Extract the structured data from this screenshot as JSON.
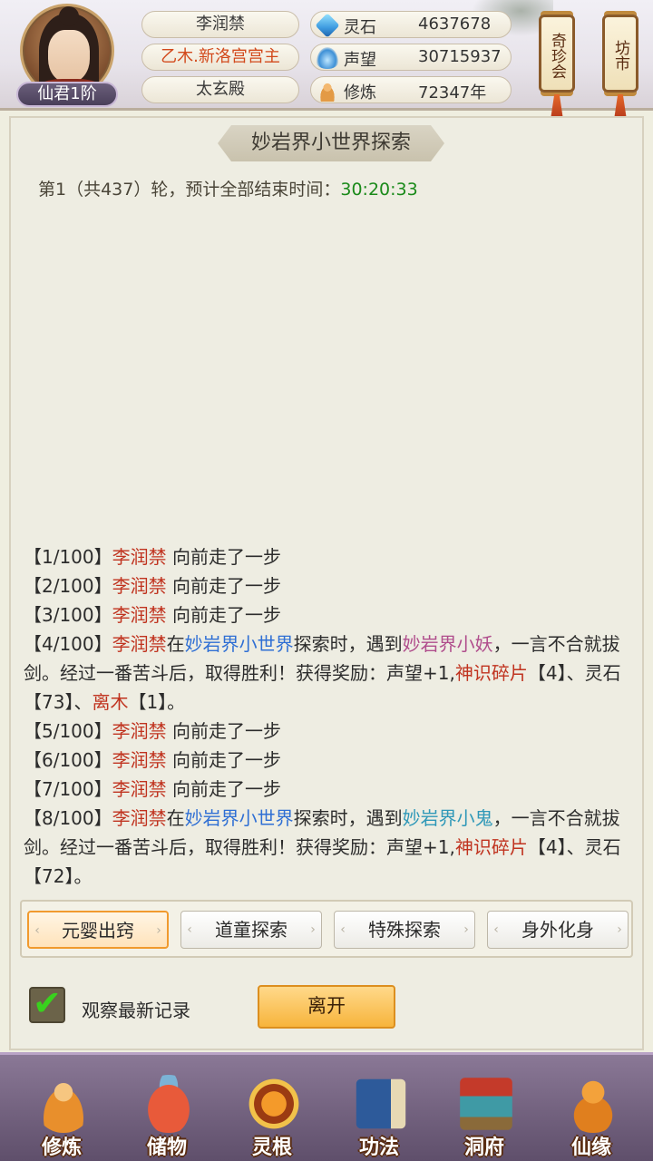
{
  "header": {
    "rank": "仙君1阶",
    "name": "李润禁",
    "title": "乙木.新洛宫宫主",
    "location": "太玄殿",
    "resources": [
      {
        "icon": "spirit-stone-icon",
        "label": "灵石",
        "value": "4637678"
      },
      {
        "icon": "fame-icon",
        "label": "声望",
        "value": "30715937"
      },
      {
        "icon": "cultivation-icon",
        "label": "修炼",
        "value": "72347年"
      }
    ],
    "scroll_buttons": [
      {
        "label": "奇珍会"
      },
      {
        "label": "坊市"
      }
    ]
  },
  "panel": {
    "title": "妙岩界小世界探索",
    "round_prefix": "第1（共437）轮，预计全部结束时间：",
    "round_time": "30:20:33"
  },
  "log": [
    {
      "idx": "【1/100】",
      "name": "李润禁",
      "text": " 向前走了一步"
    },
    {
      "idx": "【2/100】",
      "name": "李润禁",
      "text": " 向前走了一步"
    },
    {
      "idx": "【3/100】",
      "name": "李润禁",
      "text": " 向前走了一步"
    },
    {
      "idx": "【4/100】",
      "name": "李润禁",
      "t1": "在",
      "place": "妙岩界小世界",
      "t2": "探索时，遇到",
      "monster": "妙岩界小妖",
      "t3": "，一言不合就拔剑。经过一番苦斗后，取得胜利！获得奖励：声望+1,",
      "item1": "神识碎片",
      "t4": "【4】、灵石【73】、",
      "item2": "离木",
      "t5": "【1】。"
    },
    {
      "idx": "【5/100】",
      "name": "李润禁",
      "text": " 向前走了一步"
    },
    {
      "idx": "【6/100】",
      "name": "李润禁",
      "text": " 向前走了一步"
    },
    {
      "idx": "【7/100】",
      "name": "李润禁",
      "text": " 向前走了一步"
    },
    {
      "idx": "【8/100】",
      "name": "李润禁",
      "t1": "在",
      "place": "妙岩界小世界",
      "t2": "探索时，遇到",
      "monster": "妙岩界小鬼",
      "t3": "，一言不合就拔剑。经过一番苦斗后，取得胜利！获得奖励：声望+1,",
      "item1": "神识碎片",
      "t4": "【4】、灵石【72】。"
    }
  ],
  "tabs": [
    {
      "label": "元婴出窍",
      "active": true
    },
    {
      "label": "道童探索",
      "active": false
    },
    {
      "label": "特殊探索",
      "active": false
    },
    {
      "label": "身外化身",
      "active": false
    }
  ],
  "controls": {
    "watch_latest_label": "观察最新记录",
    "watch_latest_checked": true,
    "leave_label": "离开"
  },
  "nav": [
    {
      "label": "修炼",
      "icon": "meditate-icon"
    },
    {
      "label": "储物",
      "icon": "storage-bag-icon"
    },
    {
      "label": "灵根",
      "icon": "spirit-root-icon"
    },
    {
      "label": "功法",
      "icon": "technique-book-icon"
    },
    {
      "label": "洞府",
      "icon": "cave-dwelling-icon"
    },
    {
      "label": "仙缘",
      "icon": "gourd-icon"
    }
  ],
  "colors": {
    "name": "#c0331f",
    "place": "#2f6fd4",
    "monster1": "#b04d8c",
    "monster2": "#2f98b8",
    "time": "#1a8a1a",
    "active_tab_border": "#f19a2e"
  }
}
